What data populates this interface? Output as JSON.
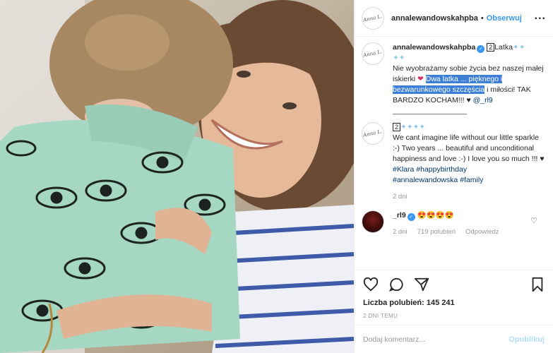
{
  "photo": {
    "alt": "mother hugging child"
  },
  "header": {
    "username": "annalewandowskahpba",
    "separator": "•",
    "follow_label": "Obserwuj",
    "more_label": "..."
  },
  "caption": {
    "username": "annalewandowskahpba",
    "badge": "2",
    "title": "Latka",
    "line1": "Nie wyobrażamy sobie życia bez naszej małej iskierki",
    "highlight": "Dwa latka ... pięknego i bezwarunkowego szczęścia",
    "line2": " i miłości! TAK BARDZO KOCHAM!!!",
    "mention": "@_rl9",
    "divider": "__________________"
  },
  "comment_en": {
    "badge": "2",
    "text": "We cant imagine life without our little sparkle :-) Two years ... beautiful and unconditional happiness and love :-) I love you so much !!!",
    "hashtags1": "#Klara #happybirthday",
    "hashtags2": "#annalewandowska #family",
    "time": "2 dni"
  },
  "reply": {
    "username": "_rl9",
    "emojis": "😍😍😍😍",
    "time": "2 dni",
    "likes": "719 polubień",
    "reply_label": "Odpowiedz"
  },
  "stats": {
    "likes_label": "Liczba polubień: 145 241",
    "ago": "2 DNI TEMU"
  },
  "composer": {
    "placeholder": "Dodaj komentarz...",
    "publish_label": "Opublikuj"
  },
  "colors": {
    "accent": "#3897f0",
    "highlight": "#3d7fd6",
    "muted": "#999999"
  }
}
